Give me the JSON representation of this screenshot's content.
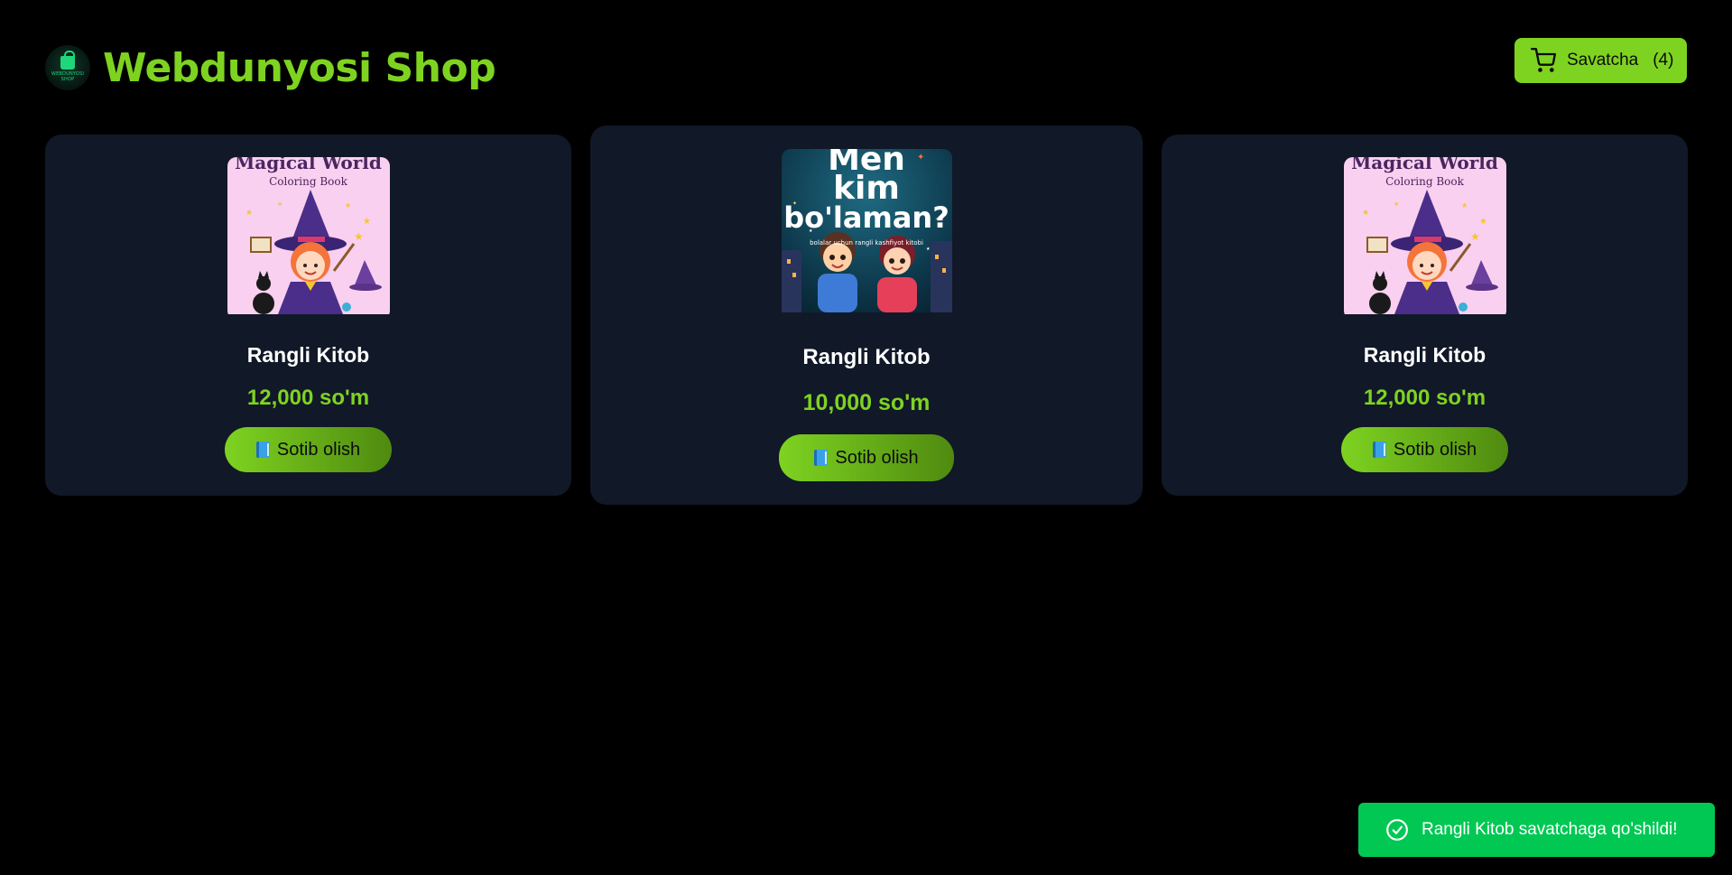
{
  "header": {
    "logo_text": "WEBDUNYOSI SHOP",
    "title": "Webdunyosi Shop",
    "cart_label": "Savatcha",
    "cart_count": "(4)"
  },
  "products": [
    {
      "name": "Rangli Kitob",
      "price": "12,000 so'm",
      "button_label": "Sotib olish",
      "cover_title": "Magical World",
      "cover_subtitle": "Coloring Book"
    },
    {
      "name": "Rangli Kitob",
      "price": "10,000 so'm",
      "button_label": "Sotib olish",
      "cover_title_line1": "Men",
      "cover_title_line2": "kim",
      "cover_title_line3": "bo'laman?",
      "cover_subtitle": "bolalar uchun rangli kashfiyot kitobi"
    },
    {
      "name": "Rangli Kitob",
      "price": "12,000 so'm",
      "button_label": "Sotib olish",
      "cover_title": "Magical World",
      "cover_subtitle": "Coloring Book"
    }
  ],
  "toast": {
    "message": "Rangli Kitob savatchaga qo'shildi!"
  },
  "colors": {
    "background": "#000000",
    "card": "#111827",
    "accent": "#7ed321",
    "toast": "#00c853"
  },
  "icons": [
    "shopping-bag-icon",
    "cart-icon",
    "book-icon",
    "check-circle-icon"
  ]
}
